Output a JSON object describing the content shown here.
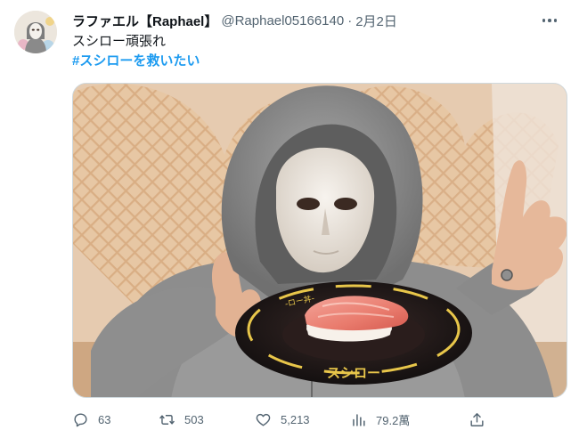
{
  "tweet": {
    "author": {
      "display_name": "ラファエル【Raphael】",
      "handle": "@Raphael05166140",
      "avatar_icon": "masked-figure-avatar"
    },
    "separator": "·",
    "date": "2月2日",
    "text_lines": [
      "スシロー頑張れ",
      "#スシローを救いたい"
    ],
    "media": {
      "plate_text": "スシロー",
      "plate_rim_text": "-ロー丼-"
    },
    "stats": {
      "replies": "63",
      "retweets": "503",
      "likes": "5,213",
      "views": "79.2萬"
    },
    "icons": {
      "reply": "comment-bubble-icon",
      "retweet": "retweet-arrows-icon",
      "like": "heart-icon",
      "views": "bar-chart-icon",
      "share": "share-upload-icon",
      "more": "more-dots-icon"
    },
    "colors": {
      "link": "#1d9bf0",
      "secondary_text": "#536471",
      "primary_text": "#0f1419"
    }
  }
}
